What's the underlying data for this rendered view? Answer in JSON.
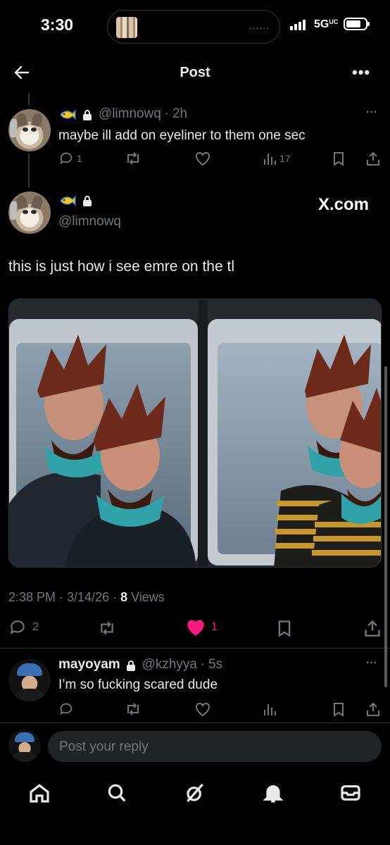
{
  "status_bar": {
    "time": "3:30",
    "network": "5G",
    "network_sub": "UC",
    "island_dots": "......"
  },
  "header": {
    "title": "Post",
    "back_icon": "arrow-left-icon",
    "more_icon": "more-horizontal-icon",
    "more_label": "•••"
  },
  "parent_post": {
    "handle": "@limnowq",
    "time": "· 2h",
    "text": "maybe ill add on eyeliner to them one sec",
    "replies": "1",
    "views": "17",
    "more_label": "···"
  },
  "main_post": {
    "handle": "@limnowq",
    "watermark": "X.com",
    "text": "this is just how i see emre on the tl",
    "timestamp": "2:38 PM · 3/14/26 · ",
    "views_count": "8",
    "views_label": " Views",
    "replies": "2",
    "likes": "1",
    "liked": true,
    "like_color": "#f91880"
  },
  "reply_post": {
    "name": "mayoyam",
    "handle": "@kzhyya",
    "time": "· 5s",
    "text": "I’m so fucking scared dude",
    "more_label": "···"
  },
  "composer": {
    "placeholder": "Post your reply"
  },
  "tab_bar": {
    "items": [
      "home-icon",
      "search-icon",
      "grok-icon",
      "notifications-icon",
      "messages-icon"
    ]
  },
  "colors": {
    "background": "#000000",
    "text": "#e7e9ea",
    "muted": "#71767b",
    "divider": "#2f3336",
    "like": "#f91880"
  }
}
